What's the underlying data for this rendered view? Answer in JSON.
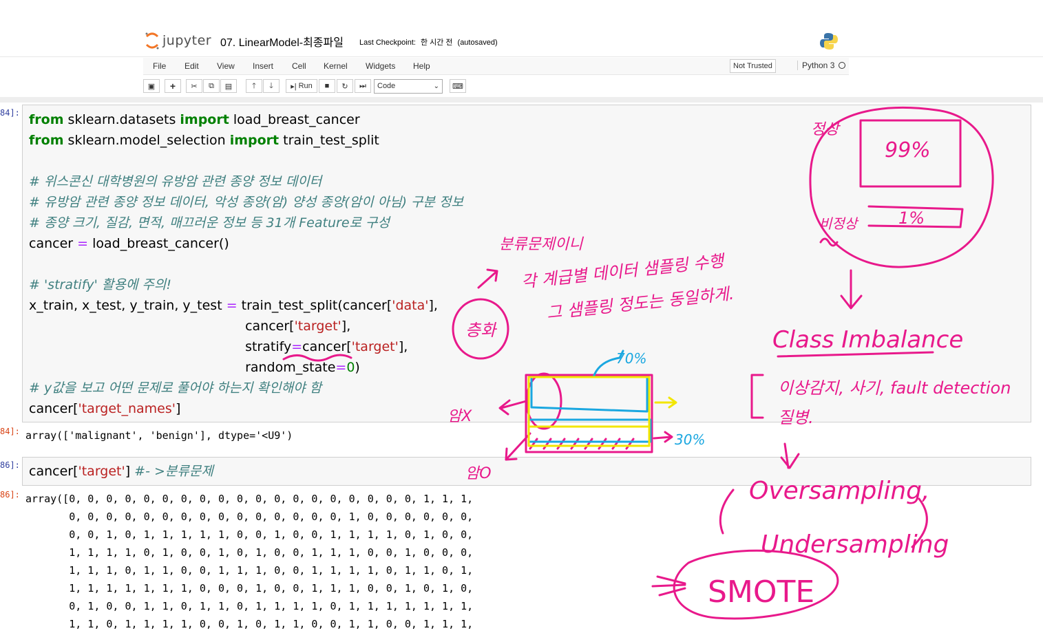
{
  "header": {
    "logo_text": "jupyter",
    "notebook_title": "07. LinearModel-최종파일",
    "checkpoint_label": "Last Checkpoint:",
    "checkpoint_time": "한 시간 전",
    "autosave": "(autosaved)"
  },
  "menu": {
    "items": [
      "File",
      "Edit",
      "View",
      "Insert",
      "Cell",
      "Kernel",
      "Widgets",
      "Help"
    ],
    "not_trusted": "Not Trusted",
    "kernel_name": "Python 3"
  },
  "toolbar": {
    "run_label": "Run",
    "cell_type": "Code"
  },
  "cells": {
    "c1": {
      "in_prompt": "84]:",
      "out_prompt": "84]:",
      "output": "array(['malignant', 'benign'], dtype='<U9')"
    },
    "c2": {
      "in_prompt": "86]:",
      "out_prompt": "86]:",
      "output_lines": [
        "array([0, 0, 0, 0, 0, 0, 0, 0, 0, 0, 0, 0, 0, 0, 0, 0, 0, 0, 0, 1, 1, 1,",
        "       0, 0, 0, 0, 0, 0, 0, 0, 0, 0, 0, 0, 0, 0, 0, 1, 0, 0, 0, 0, 0, 0,",
        "       0, 0, 1, 0, 1, 1, 1, 1, 1, 0, 0, 1, 0, 0, 1, 1, 1, 1, 0, 1, 0, 0,",
        "       1, 1, 1, 1, 0, 1, 0, 0, 1, 0, 1, 0, 0, 1, 1, 1, 0, 0, 1, 0, 0, 0,",
        "       1, 1, 1, 0, 1, 1, 0, 0, 1, 1, 1, 0, 0, 1, 1, 1, 1, 0, 1, 1, 0, 1,",
        "       1, 1, 1, 1, 1, 1, 1, 0, 0, 0, 1, 0, 0, 1, 1, 1, 0, 0, 1, 0, 1, 0,",
        "       0, 1, 0, 0, 1, 1, 0, 1, 1, 0, 1, 1, 1, 1, 0, 1, 1, 1, 1, 1, 1, 1,",
        "       1, 1, 0, 1, 1, 1, 1, 0, 0, 1, 0, 1, 1, 0, 0, 1, 1, 0, 0, 1, 1, 1,"
      ]
    }
  },
  "code": {
    "l1_a": "from",
    "l1_b": " sklearn.datasets ",
    "l1_c": "import",
    "l1_d": " load_breast_cancer",
    "l2_a": "from",
    "l2_b": " sklearn.model_selection ",
    "l2_c": "import",
    "l2_d": " train_test_split",
    "c1": "# 위스콘신 대학병원의 유방암 관련 종양 정보 데이터",
    "c2": "# 유방암 관련 종양 정보 데이터, 악성 종양(암) 양성 종양(암이 아님) 구분 정보",
    "c3": "# 종양 크기, 질감, 면적, 매끄러운 정보 등 31개 Feature로 구성",
    "l6_a": "cancer ",
    "l6_b": "=",
    "l6_c": " load_breast_cancer()",
    "c4": "# 'stratify' 활용에 주의!",
    "l8_a": "x_train, x_test, y_train, y_test ",
    "l8_b": "=",
    "l8_c": " train_test_split(cancer[",
    "l8_d": "'data'",
    "l8_e": "],",
    "l9_a": "cancer[",
    "l9_b": "'target'",
    "l9_c": "],",
    "l10_a": "stratify",
    "l10_b": "=",
    "l10_c": "cancer[",
    "l10_d": "'target'",
    "l10_e": "],",
    "l11_a": "random_state",
    "l11_b": "=",
    "l11_c": "0",
    "l11_d": ")",
    "c5": "# y값을 보고 어떤 문제로 풀어야 하는지 확인해야 함",
    "l13_a": "cancer[",
    "l13_b": "'target_names'",
    "l13_c": "]",
    "l14_a": "cancer[",
    "l14_b": "'target'",
    "l14_c": "] ",
    "l14_d": "#- >분류문제"
  },
  "annotations": {
    "a_normal": "정상",
    "a_99": "99%",
    "a_abnormal": "비정상",
    "a_1": "1%",
    "a_clsprob": "분류문제이니",
    "a_line1": "각 계급별 데이터 샘플링 수행",
    "a_line2": "그 샘플링 정도는 동일하게.",
    "a_strat": "층화",
    "a_amx": "암X",
    "a_amo": "암O",
    "a_30": "30%",
    "a_70": "70%",
    "a_ci": "Class Imbalance",
    "a_list1": "이상감지, 사기, fault detection",
    "a_list2": "질병.",
    "a_over": "Oversampling,",
    "a_under": "Undersampling",
    "a_smote": "SMOTE"
  },
  "colors": {
    "accent_pen": "#e8198b",
    "blue_pen": "#1aa7e0",
    "yellow_pen": "#f2e600",
    "keyword": "#008000",
    "string": "#ba2121",
    "comment": "#408080"
  }
}
